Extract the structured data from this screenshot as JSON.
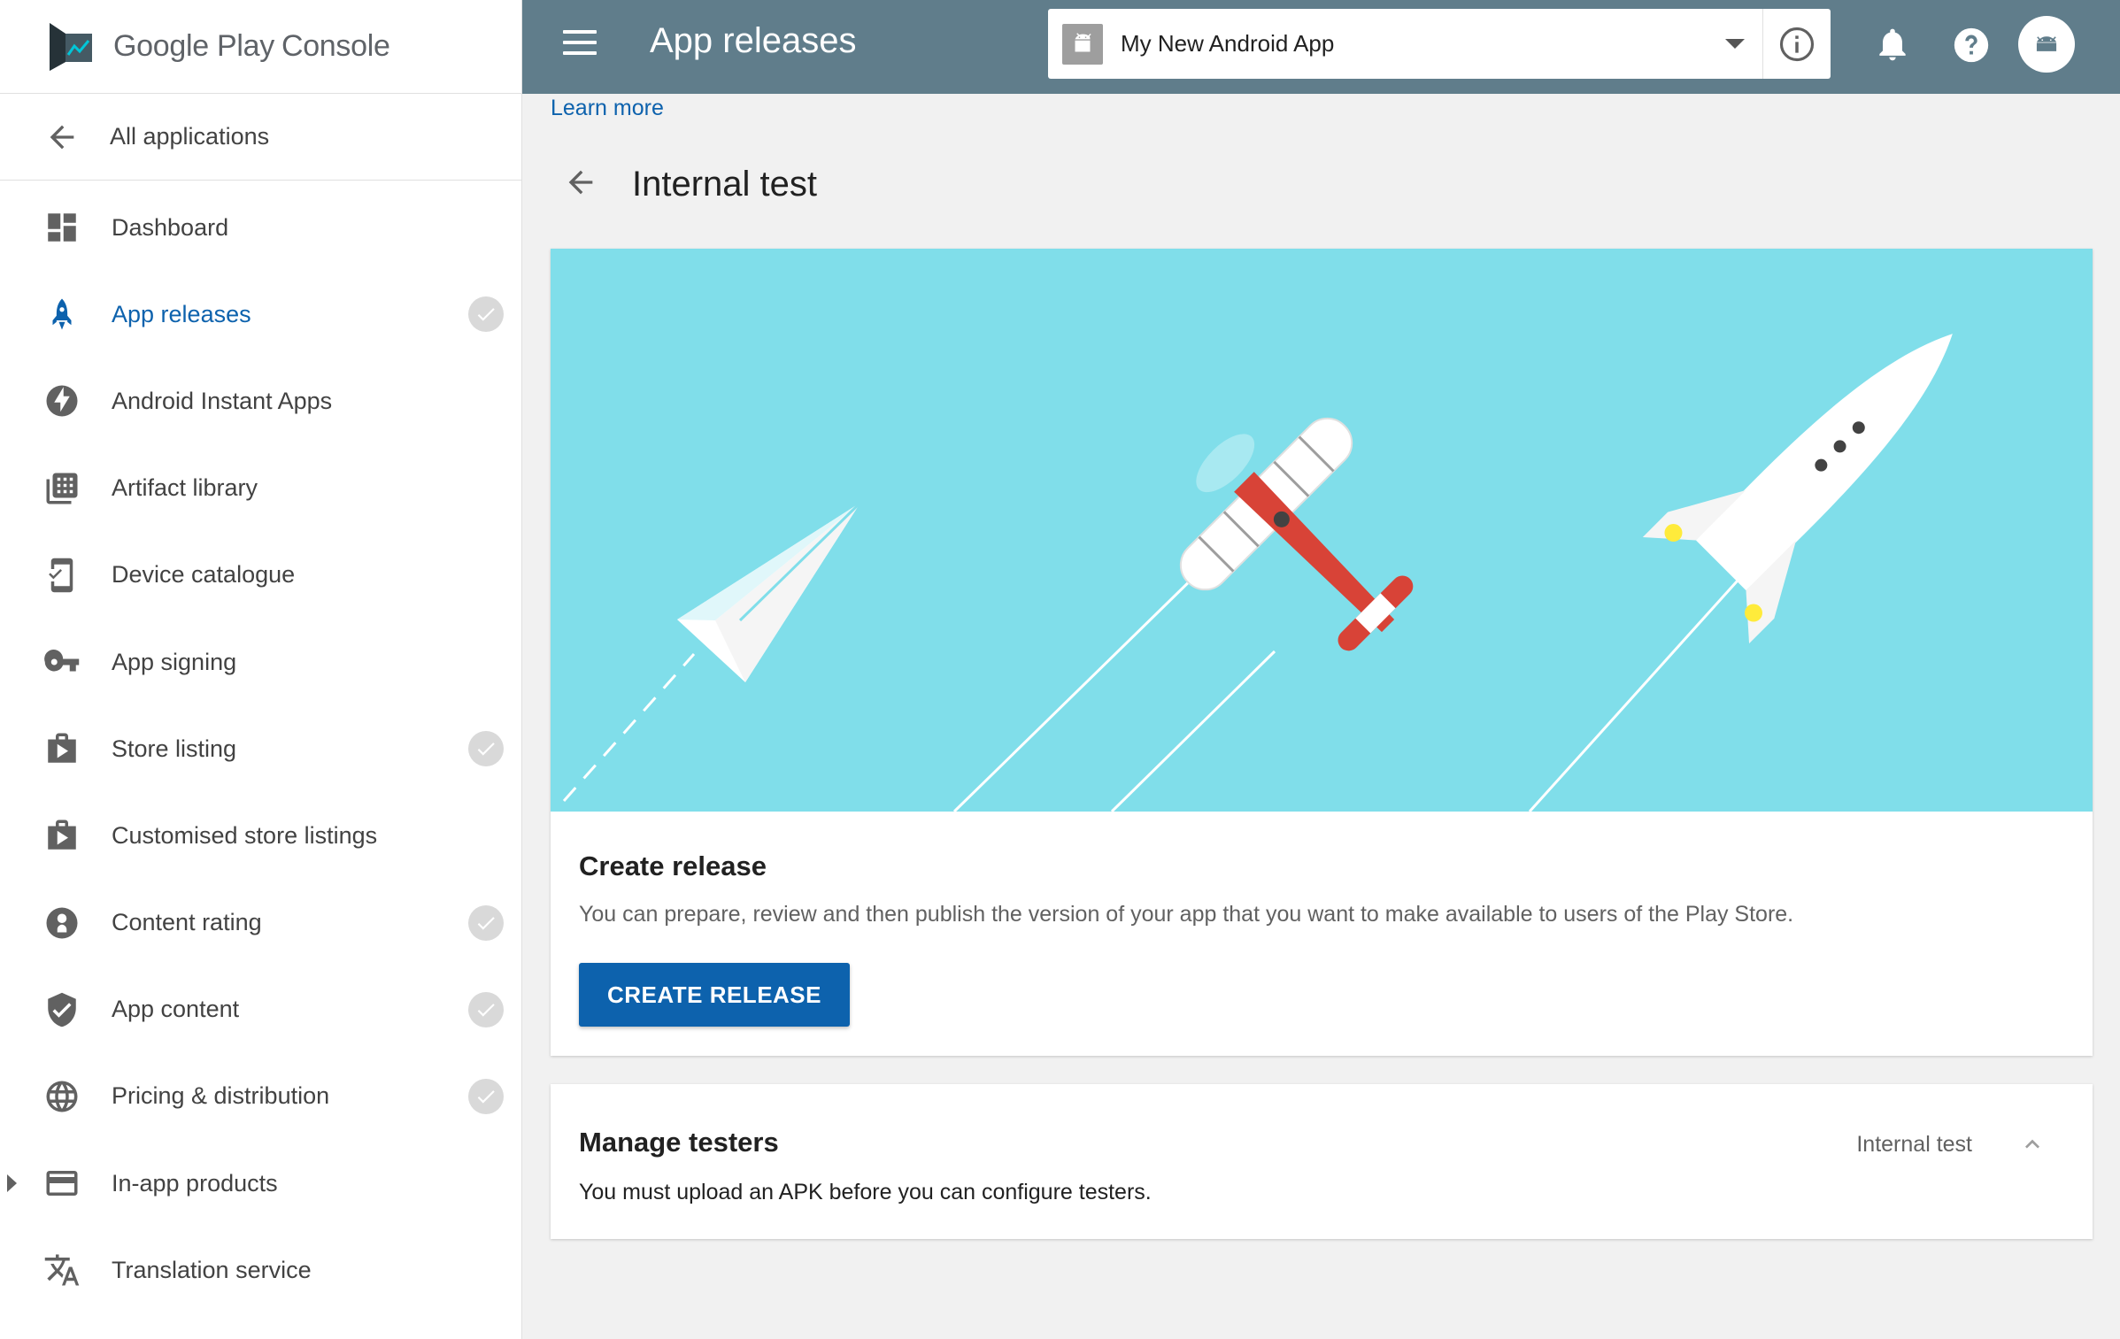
{
  "brand": {
    "name": "Google Play",
    "product": "Console"
  },
  "sidebar": {
    "back_label": "All applications",
    "items": [
      {
        "label": "Dashboard",
        "icon": "dashboard-icon",
        "checked": false
      },
      {
        "label": "App releases",
        "icon": "rocket-icon",
        "checked": true,
        "active": true
      },
      {
        "label": "Android Instant Apps",
        "icon": "bolt-icon",
        "checked": false
      },
      {
        "label": "Artifact library",
        "icon": "library-icon",
        "checked": false
      },
      {
        "label": "Device catalogue",
        "icon": "device-icon",
        "checked": false
      },
      {
        "label": "App signing",
        "icon": "key-icon",
        "checked": false
      },
      {
        "label": "Store listing",
        "icon": "store-icon",
        "checked": true
      },
      {
        "label": "Customised store listings",
        "icon": "store-icon",
        "checked": false
      },
      {
        "label": "Content rating",
        "icon": "rating-icon",
        "checked": true
      },
      {
        "label": "App content",
        "icon": "shield-icon",
        "checked": true
      },
      {
        "label": "Pricing & distribution",
        "icon": "globe-icon",
        "checked": true
      },
      {
        "label": "In-app products",
        "icon": "card-icon",
        "checked": false,
        "expandable": true
      },
      {
        "label": "Translation service",
        "icon": "translate-icon",
        "checked": false
      }
    ]
  },
  "header": {
    "title": "App releases",
    "app_selector": {
      "value": "My New Android App"
    }
  },
  "main": {
    "learn_more": "Learn more",
    "page_title": "Internal test",
    "release_card": {
      "title": "Create release",
      "description": "You can prepare, review and then publish the version of your app that you want to make available to users of the Play Store.",
      "button": "CREATE RELEASE"
    },
    "testers_card": {
      "title": "Manage testers",
      "description": "You must upload an APK before you can configure testers.",
      "tag": "Internal test"
    }
  },
  "colors": {
    "header": "#607d8b",
    "accent": "#0d62ad",
    "hero": "#80deea"
  }
}
